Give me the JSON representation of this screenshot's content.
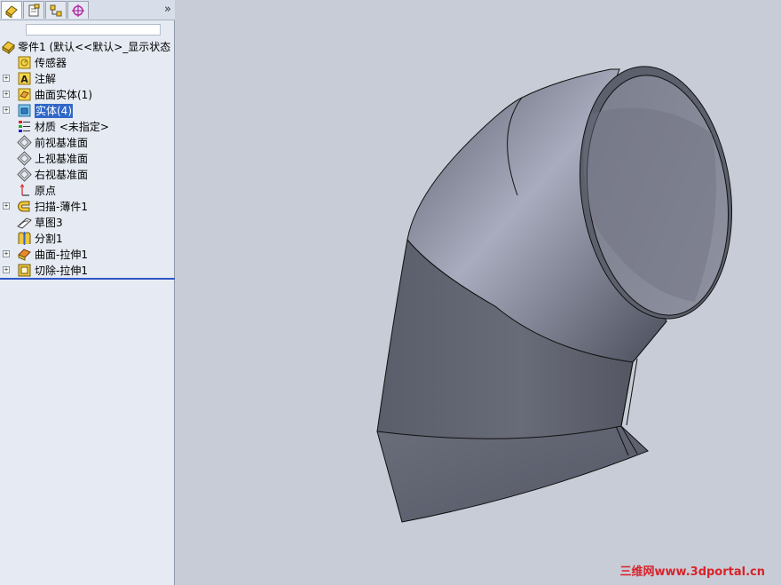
{
  "panel": {
    "tabs": [
      {
        "name": "feature-manager-tab",
        "icon": "feature-manager-icon"
      },
      {
        "name": "property-manager-tab",
        "icon": "property-manager-icon"
      },
      {
        "name": "configuration-manager-tab",
        "icon": "configuration-manager-icon"
      },
      {
        "name": "dimxpert-manager-tab",
        "icon": "dimxpert-icon"
      }
    ],
    "expand_label": "»",
    "filter_value": ""
  },
  "tree": {
    "root": "零件1  (默认<<默认>_显示状态",
    "items": [
      {
        "label": "传感器",
        "icon": "sensor-icon",
        "expandable": false
      },
      {
        "label": "注解",
        "icon": "annotation-icon",
        "expandable": true
      },
      {
        "label": "曲面实体(1)",
        "icon": "surface-bodies-icon",
        "expandable": true
      },
      {
        "label": "实体(4)",
        "icon": "solid-bodies-icon",
        "expandable": true,
        "selected": true
      },
      {
        "label": "材质 <未指定>",
        "icon": "material-icon",
        "expandable": false
      },
      {
        "label": "前视基准面",
        "icon": "plane-icon",
        "expandable": false
      },
      {
        "label": "上视基准面",
        "icon": "plane-icon",
        "expandable": false
      },
      {
        "label": "右视基准面",
        "icon": "plane-icon",
        "expandable": false
      },
      {
        "label": "原点",
        "icon": "origin-icon",
        "expandable": false
      },
      {
        "label": "扫描-薄件1",
        "icon": "sweep-icon",
        "expandable": true
      },
      {
        "label": "草图3",
        "icon": "sketch-icon",
        "expandable": false
      },
      {
        "label": "分割1",
        "icon": "split-icon",
        "expandable": false
      },
      {
        "label": "曲面-拉伸1",
        "icon": "surface-extrude-icon",
        "expandable": true
      },
      {
        "label": "切除-拉伸1",
        "icon": "cut-extrude-icon",
        "expandable": true
      }
    ]
  },
  "viewport": {
    "watermark": "三维网www.3dportal.cn"
  },
  "colors": {
    "panel_bg": "#e6ebf3",
    "viewport_bg": "#c8ccd6",
    "selection": "#3168c8",
    "watermark": "#d8232a"
  }
}
